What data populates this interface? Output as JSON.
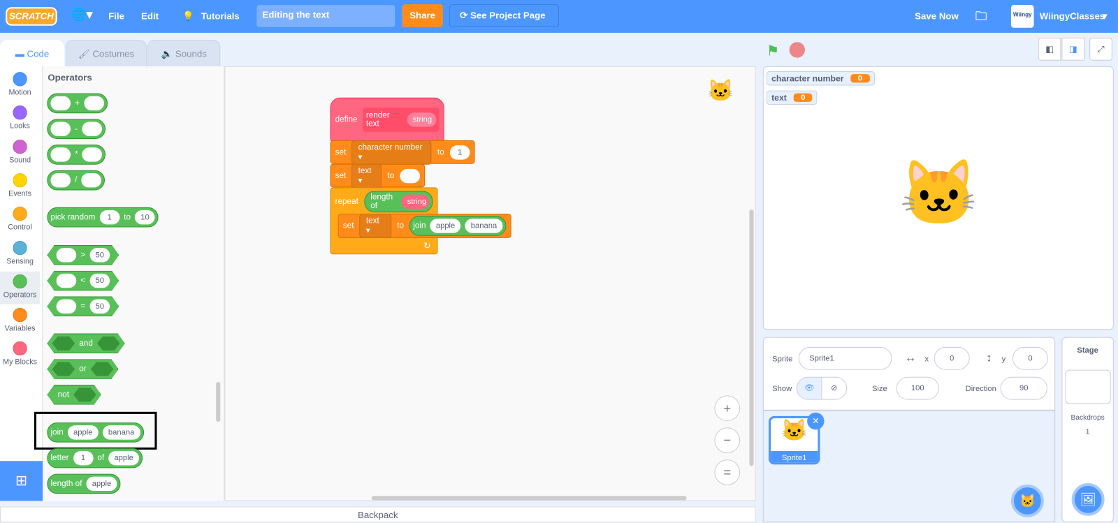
{
  "menubar": {
    "logo": "SCRATCH",
    "file": "File",
    "edit": "Edit",
    "tutorials": "Tutorials",
    "project_title": "Editing the text",
    "share": "Share",
    "see_project": "See Project Page",
    "save_now": "Save Now",
    "username": "WiingyClasses",
    "avatar_text": "Wiingy"
  },
  "tabs": {
    "code": "Code",
    "costumes": "Costumes",
    "sounds": "Sounds"
  },
  "categories": [
    {
      "label": "Motion",
      "color": "#4c97ff"
    },
    {
      "label": "Looks",
      "color": "#9966ff"
    },
    {
      "label": "Sound",
      "color": "#cf63cf"
    },
    {
      "label": "Events",
      "color": "#ffd500"
    },
    {
      "label": "Control",
      "color": "#ffab19"
    },
    {
      "label": "Sensing",
      "color": "#5cb1d6"
    },
    {
      "label": "Operators",
      "color": "#59c059"
    },
    {
      "label": "Variables",
      "color": "#ff8c1a"
    },
    {
      "label": "My Blocks",
      "color": "#ff6680"
    }
  ],
  "palette": {
    "heading": "Operators",
    "plus": "+",
    "minus": "-",
    "times": "*",
    "divide": "/",
    "pick_random": "pick random",
    "rand_from": "1",
    "rand_to_label": "to",
    "rand_to": "10",
    "gt": ">",
    "lt": "<",
    "eq": "=",
    "cmp_value": "50",
    "and": "and",
    "or": "or",
    "not": "not",
    "join": "join",
    "join_a": "apple",
    "join_b": "banana",
    "letter": "letter",
    "letter_n": "1",
    "of": "of",
    "letter_word": "apple",
    "length_of": "length of",
    "length_word": "apple"
  },
  "script": {
    "define": "define",
    "proc_name": "render text",
    "param": "string",
    "set": "set",
    "var_char": "character number",
    "to": "to",
    "char_value": "1",
    "var_text": "text",
    "text_value": "",
    "repeat": "repeat",
    "length_of": "length of",
    "join": "join",
    "join_a": "apple",
    "join_b": "banana"
  },
  "zoom": {
    "in": "+",
    "out": "−",
    "reset": "="
  },
  "backpack": "Backpack",
  "monitors": [
    {
      "label": "character number",
      "value": "0"
    },
    {
      "label": "text",
      "value": "0"
    }
  ],
  "sprite_info": {
    "sprite_label": "Sprite",
    "sprite_name": "Sprite1",
    "x_label": "x",
    "x": "0",
    "y_label": "y",
    "y": "0",
    "show_label": "Show",
    "size_label": "Size",
    "size": "100",
    "direction_label": "Direction",
    "direction": "90"
  },
  "sprites": [
    {
      "name": "Sprite1"
    }
  ],
  "stage_pane": {
    "title": "Stage",
    "backdrops_label": "Backdrops",
    "backdrops": "1"
  }
}
